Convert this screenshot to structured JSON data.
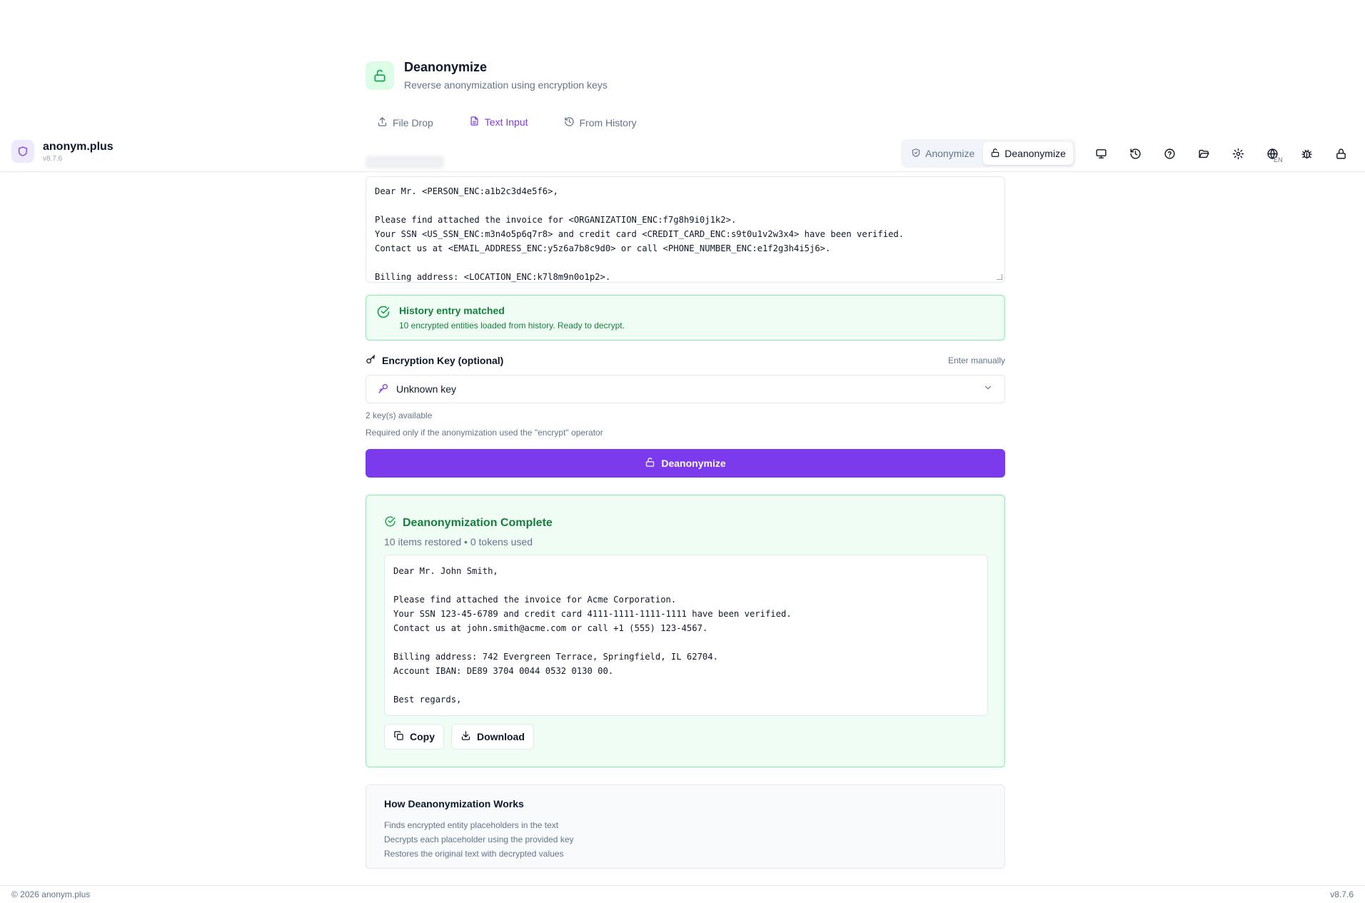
{
  "page": {
    "title": "Deanonymize",
    "subtitle": "Reverse anonymization using encryption keys"
  },
  "tabs": [
    {
      "label": "File Drop",
      "icon": "upload-icon"
    },
    {
      "label": "Text Input",
      "icon": "file-text-icon",
      "active": true
    },
    {
      "label": "From History",
      "icon": "history-icon"
    }
  ],
  "topbar": {
    "brand_name": "anonym.plus",
    "brand_version": "v8.7.6",
    "mode_anonymize": "Anonymize",
    "mode_deanonymize": "Deanonymize",
    "language": "EN"
  },
  "input": {
    "text": "Dear Mr. <PERSON_ENC:a1b2c3d4e5f6>,\n\nPlease find attached the invoice for <ORGANIZATION_ENC:f7g8h9i0j1k2>.\nYour SSN <US_SSN_ENC:m3n4o5p6q7r8> and credit card <CREDIT_CARD_ENC:s9t0u1v2w3x4> have been verified.\nContact us at <EMAIL_ADDRESS_ENC:y5z6a7b8c9d0> or call <PHONE_NUMBER_ENC:e1f2g3h4i5j6>.\n\nBilling address: <LOCATION_ENC:k7l8m9n0o1p2>."
  },
  "match": {
    "title": "History entry matched",
    "description": "10 encrypted entities loaded from history. Ready to decrypt."
  },
  "key": {
    "label": "Encryption Key (optional)",
    "enter_manually": "Enter manually",
    "selected": "Unknown key",
    "available": "2 key(s) available",
    "hint": "Required only if the anonymization used the \"encrypt\" operator"
  },
  "action": {
    "deanonymize_label": "Deanonymize"
  },
  "result": {
    "title": "Deanonymization Complete",
    "meta": "10 items restored • 0 tokens used",
    "text": "Dear Mr. John Smith,\n\nPlease find attached the invoice for Acme Corporation.\nYour SSN 123-45-6789 and credit card 4111-1111-1111-1111 have been verified.\nContact us at john.smith@acme.com or call +1 (555) 123-4567.\n\nBilling address: 742 Evergreen Terrace, Springfield, IL 62704.\nAccount IBAN: DE89 3704 0044 0532 0130 00.\n\nBest regards,",
    "copy_label": "Copy",
    "download_label": "Download"
  },
  "how": {
    "title": "How Deanonymization Works",
    "steps": [
      "Finds encrypted entity placeholders in the text",
      "Decrypts each placeholder using the provided key",
      "Restores the original text with decrypted values"
    ]
  },
  "footer": {
    "copyright": "© 2026 anonym.plus",
    "version": "v8.7.6"
  },
  "colors": {
    "accent": "#7c3aed",
    "success": "#15803d",
    "success_bg": "#f0fdf4"
  }
}
